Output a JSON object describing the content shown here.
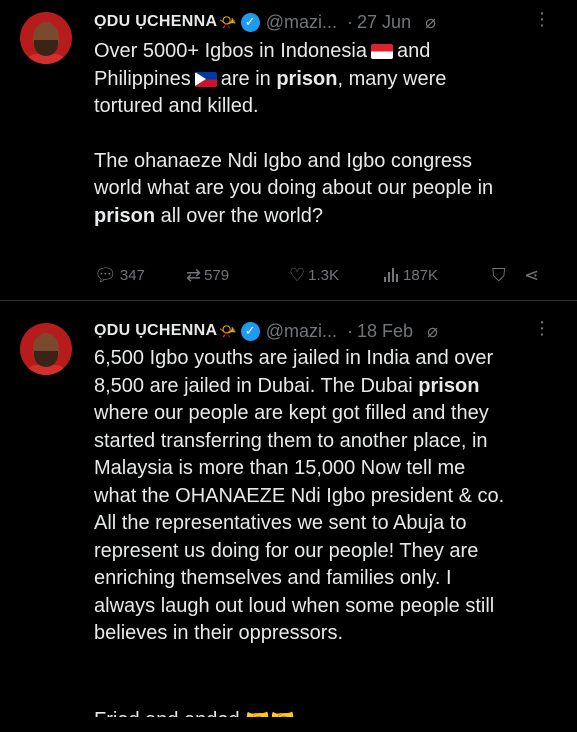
{
  "tweets": [
    {
      "author_name": "ỌDU ỤCHENNA",
      "handle": "@mazi...",
      "separator": "·",
      "date": "27 Jun",
      "text": {
        "line1a": "Over 5000+ Igbos in Indonesia",
        "line1b": "and",
        "line2a": "Philippines",
        "line2b": "are in",
        "line2_bold": "prison",
        "line2c": ", many were",
        "line3": "tortured and killed.",
        "p2_line1": "The ohanaeze Ndi Igbo and Igbo congress",
        "p2_line2": "world what are you doing about our people in",
        "p2_bold": "prison",
        "p2_line3": " all over the world?"
      },
      "stats": {
        "replies": "347",
        "retweets": "579",
        "likes": "1.3K",
        "views": "187K"
      }
    },
    {
      "author_name": "ỌDU ỤCHENNA",
      "handle": "@mazi...",
      "separator": "·",
      "date": "18 Feb",
      "lines": [
        "6,500 Igbo youths are jailed in India and over",
        "8,500 are jailed in Dubai. The Dubai ",
        "where our people are kept got filled and they",
        "started transferring them to another place, in",
        "Malaysia is more than 15,000 Now tell me",
        "what the OHANAEZE Ndi Igbo president & co.",
        "All the representatives we sent to Abuja to",
        "represent us doing for our people! They are",
        "enriching themselves and families only. I",
        "always laugh out loud when some people still",
        "believes in their oppressors."
      ],
      "bold_word": "prison",
      "cut_line": "Fried and ended"
    }
  ],
  "icons": {
    "verified": "verified-badge-icon",
    "horn": "horn-emoji-icon",
    "grok": "grok-icon",
    "more": "more-icon",
    "reply": "reply-icon",
    "retweet": "retweet-icon",
    "like": "heart-icon",
    "views": "views-icon",
    "bookmark": "bookmark-icon",
    "share": "share-icon"
  },
  "colors": {
    "background": "#000000",
    "text": "#e7e9ea",
    "muted": "#71767b",
    "verified": "#1d9bf0",
    "avatar": "#b71c1c"
  }
}
